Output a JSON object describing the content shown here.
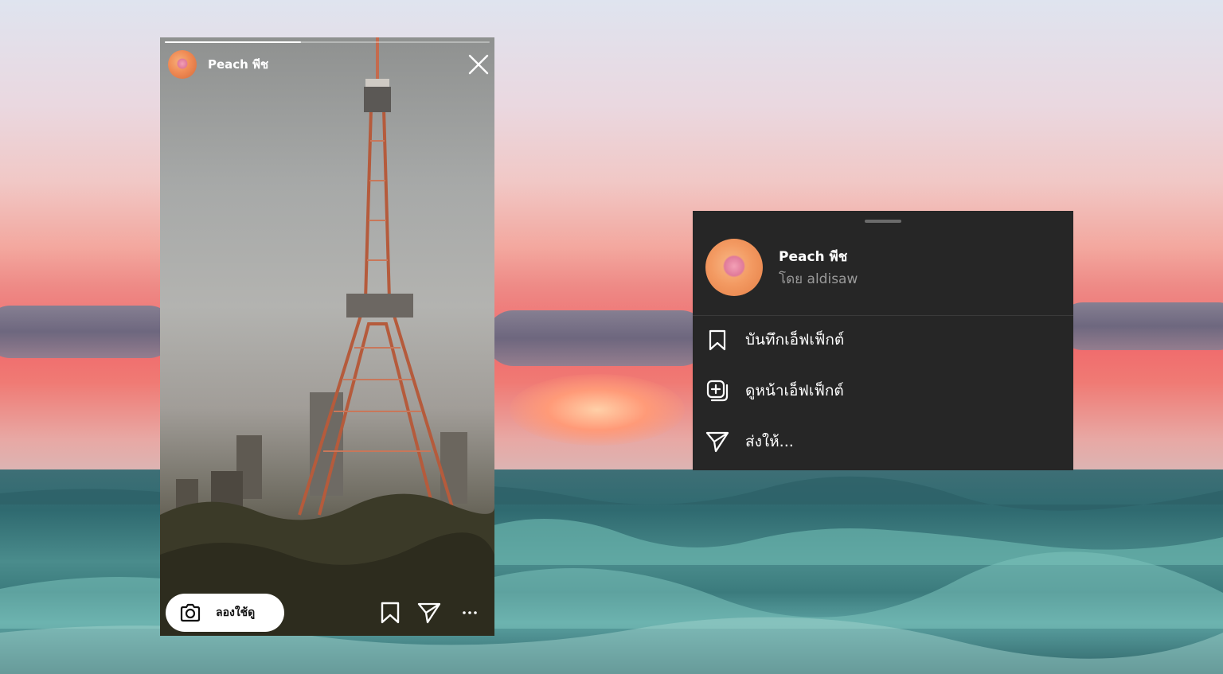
{
  "story": {
    "progress": 0.42,
    "author_name": "Peach พีช",
    "try_button_label": "ลองใช้ดู"
  },
  "sheet": {
    "effect_name": "Peach พีช",
    "creator": "โดย aldisaw",
    "items": [
      {
        "label": "บันทึกเอ็ฟเฟ็กต์",
        "icon": "bookmark-icon"
      },
      {
        "label": "ดูหน้าเอ็ฟเฟ็กต์",
        "icon": "add-effect-page-icon"
      },
      {
        "label": "ส่งให้...",
        "icon": "send-icon"
      }
    ]
  },
  "colors": {
    "sheet_bg": "#262626",
    "sheet_text": "#ffffff",
    "sheet_subtext": "#9a9a9a"
  }
}
